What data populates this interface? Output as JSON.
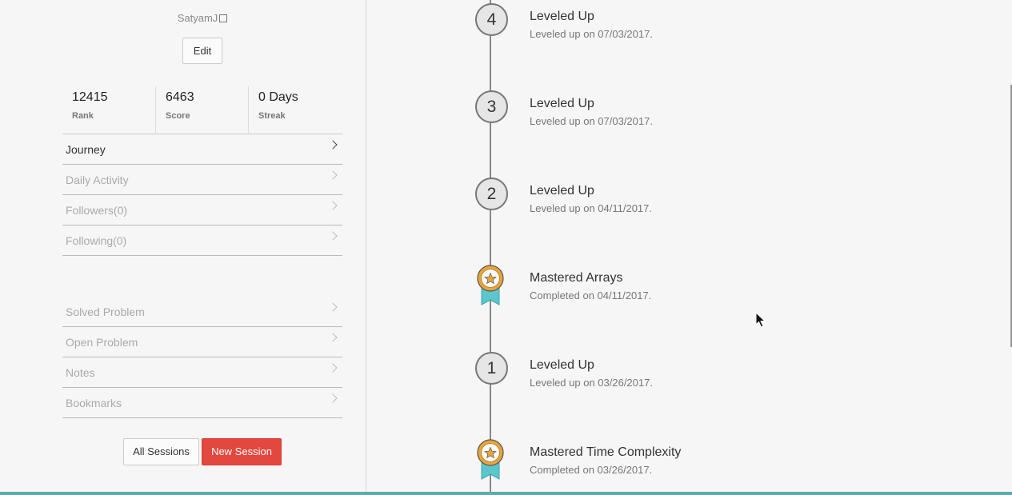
{
  "profile": {
    "username": "SatyamJ",
    "edit_label": "Edit"
  },
  "stats": [
    {
      "value": "12415",
      "label": "Rank"
    },
    {
      "value": "6463",
      "label": "Score"
    },
    {
      "value": "0 Days",
      "label": "Streak"
    }
  ],
  "menu_top": [
    {
      "label": "Journey",
      "active": true
    },
    {
      "label": "Daily Activity",
      "active": false
    },
    {
      "label": "Followers(0)",
      "active": false
    },
    {
      "label": "Following(0)",
      "active": false
    }
  ],
  "menu_bottom": [
    {
      "label": "Solved Problem"
    },
    {
      "label": "Open Problem"
    },
    {
      "label": "Notes"
    },
    {
      "label": "Bookmarks"
    }
  ],
  "sessions": {
    "all_label": "All Sessions",
    "new_label": "New Session"
  },
  "timeline": [
    {
      "kind": "level",
      "badge": "4",
      "title": "Leveled Up",
      "subtitle": "Leveled up on 07/03/2017."
    },
    {
      "kind": "level",
      "badge": "3",
      "title": "Leveled Up",
      "subtitle": "Leveled up on 07/03/2017."
    },
    {
      "kind": "level",
      "badge": "2",
      "title": "Leveled Up",
      "subtitle": "Leveled up on 04/11/2017."
    },
    {
      "kind": "medal",
      "icon": "medal-icon",
      "title": "Mastered Arrays",
      "subtitle": "Completed on 04/11/2017."
    },
    {
      "kind": "level",
      "badge": "1",
      "title": "Leveled Up",
      "subtitle": "Leveled up on 03/26/2017."
    },
    {
      "kind": "medal",
      "icon": "medal-icon",
      "title": "Mastered Time Complexity",
      "subtitle": "Completed on 03/26/2017."
    }
  ],
  "colors": {
    "accent_red": "#e2483d",
    "bottom_bar": "#5aacae",
    "medal_gold": "#e8a53a",
    "medal_ribbon": "#5cc6cf"
  }
}
